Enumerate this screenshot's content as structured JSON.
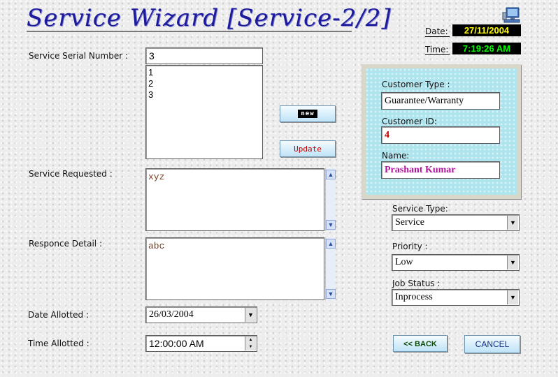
{
  "app": {
    "title": "Service Wizard [Service-2/2]"
  },
  "datetime": {
    "date_label": "Date:",
    "date_value": "27/11/2004",
    "time_label": "Time:",
    "time_value": "7:19:26 AM"
  },
  "icons": {
    "computer": "computer-icon"
  },
  "serial": {
    "label": "Service Serial Number :",
    "value": "3",
    "list": [
      "1",
      "2",
      "3"
    ]
  },
  "buttons": {
    "new": "new",
    "update": "Update",
    "back": "<< BACK",
    "cancel": "CANCEL"
  },
  "service_requested": {
    "label": "Service Requested :",
    "value": "xyz"
  },
  "responce_detail": {
    "label": "Responce Detail :",
    "value": "abc"
  },
  "date_allotted": {
    "label": "Date Allotted :",
    "value": "26/03/2004"
  },
  "time_allotted": {
    "label": "Time Allotted :",
    "value": "12:00:00 AM"
  },
  "customer": {
    "type_label": "Customer Type :",
    "type_value": "Guarantee/Warranty",
    "id_label": "Customer ID:",
    "id_value": "4",
    "name_label": "Name:",
    "name_value": "Prashant Kumar"
  },
  "service_type": {
    "label": "Service Type:",
    "value": "Service"
  },
  "priority": {
    "label": "Priority :",
    "value": "Low"
  },
  "job_status": {
    "label": "Job Status :",
    "value": "Inprocess"
  },
  "colors": {
    "title": "#1d1b9d",
    "date_value": "#ffff00",
    "time_value": "#00ff00",
    "clock_bg": "#000000",
    "customer_id": "#c00000",
    "customer_name": "#b0129a",
    "panel_bg": "#aee4ee"
  }
}
